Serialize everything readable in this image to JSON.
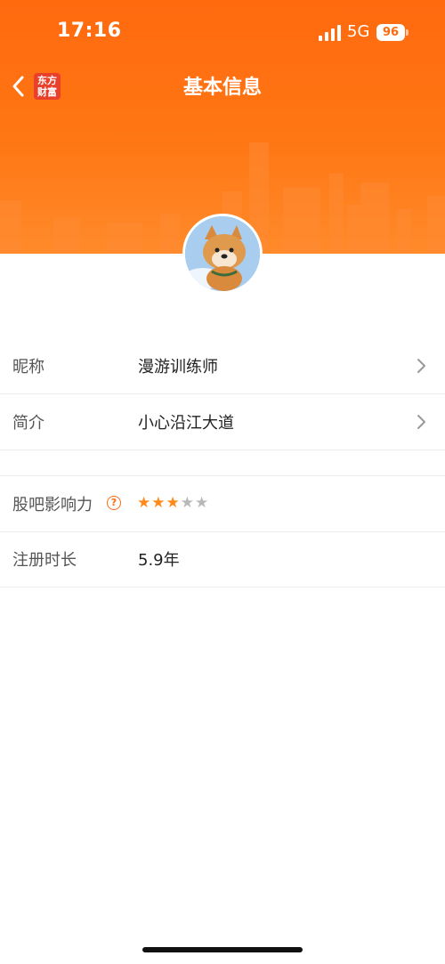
{
  "status_bar": {
    "time": "17:16",
    "network": "5G",
    "battery": "96"
  },
  "header": {
    "title": "基本信息",
    "logo_text": "东方财富",
    "back_icon": "chevron-left-icon"
  },
  "profile_rows": [
    {
      "label": "昵称",
      "value": "漫游训练师",
      "has_chevron": true
    },
    {
      "label": "简介",
      "value": "小心沿江大道",
      "has_chevron": true
    }
  ],
  "influence": {
    "label": "股吧影响力",
    "help_icon": "question-icon",
    "stars_filled": 3,
    "stars_total": 5,
    "star_color": "#ff8a1a"
  },
  "registration": {
    "label": "注册时长",
    "value": "5.9年"
  },
  "colors": {
    "accent": "#ff6a0f",
    "divider": "#ededed"
  }
}
